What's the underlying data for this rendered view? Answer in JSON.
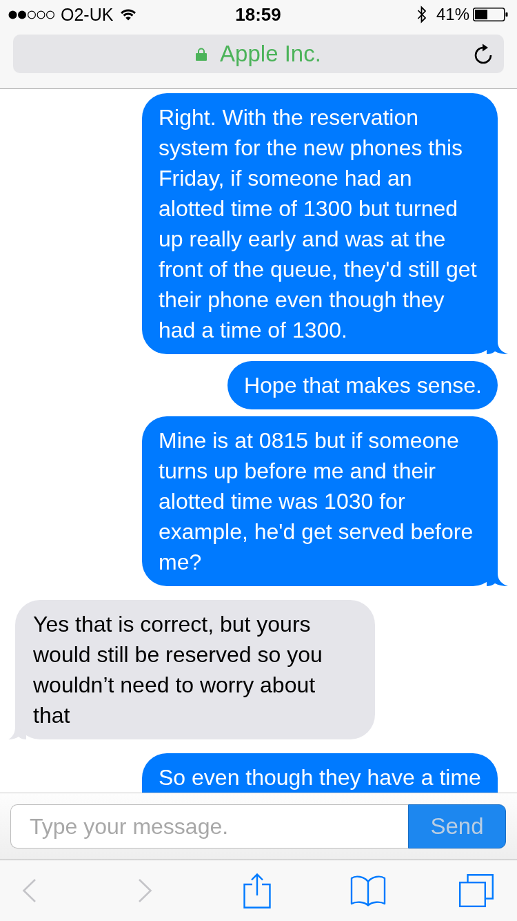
{
  "status_bar": {
    "carrier": "O2-UK",
    "time": "18:59",
    "battery": "41%"
  },
  "address_bar": {
    "title": "Apple Inc.",
    "secure": true
  },
  "messages": [
    {
      "kind": "sent",
      "text": "Right. With the reservation system for the new phones this Friday, if someone had an alotted time of 1300 but turned up really early and was at the front of the queue, they'd still get their phone even though they had a time of 1300.",
      "tail": true,
      "continues": false
    },
    {
      "kind": "sent",
      "text": "Hope that makes sense.",
      "tail": false,
      "continues": false
    },
    {
      "kind": "sent",
      "text": "Mine is at 0815 but if someone turns up before me and their alotted time was 1030 for example, he'd get served before me?",
      "tail": true,
      "continues": false
    },
    {
      "kind": "received",
      "text": "Yes that is correct, but yours would still be reserved so you wouldn’t need to worry about that",
      "tail": true,
      "continues": false
    },
    {
      "kind": "sent",
      "text": "So even though they have a time",
      "tail": false,
      "continues": true
    }
  ],
  "composer": {
    "placeholder": "Type your message.",
    "send": {
      "label": "Send",
      "disabled": true
    }
  },
  "toolbar": {
    "back": {
      "disabled": true
    },
    "forward": {
      "disabled": true
    }
  }
}
